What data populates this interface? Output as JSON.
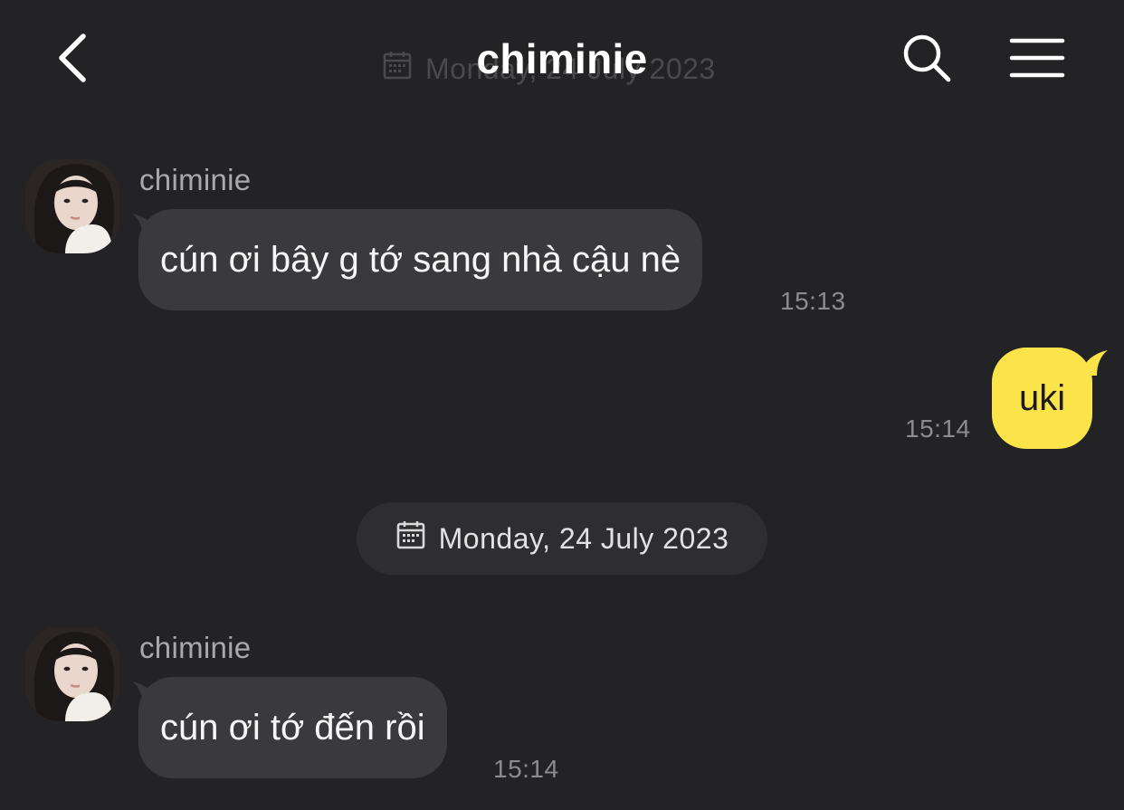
{
  "header": {
    "title": "chiminie",
    "ghost_date": "Monday, 24 July 2023"
  },
  "messages": [
    {
      "direction": "incoming",
      "sender": "chiminie",
      "text": "cún ơi bây g tớ sang nhà cậu nè",
      "time": "15:13"
    },
    {
      "direction": "outgoing",
      "text": "uki",
      "time": "15:14"
    },
    {
      "direction": "incoming",
      "sender": "chiminie",
      "text": "cún ơi tớ đến rồi",
      "time": "15:14"
    }
  ],
  "date_divider": "Monday, 24 July 2023",
  "icons": {
    "back": "chevron-left-icon",
    "search": "search-icon",
    "menu": "menu-icon",
    "calendar": "calendar-icon"
  },
  "colors": {
    "background": "#232325",
    "incoming_bubble": "#3a3a3c",
    "outgoing_bubble": "#fbe34a",
    "timestamp": "#8c8c8f",
    "sender_name": "#a9a9ab"
  }
}
